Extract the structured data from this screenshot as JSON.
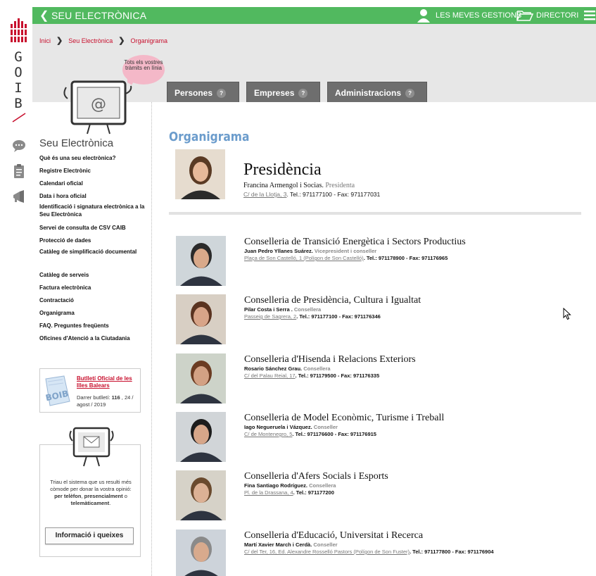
{
  "brand": {
    "letters": [
      "G",
      "O",
      "I",
      "B"
    ],
    "accent": "#c8102e",
    "green": "#51b95f"
  },
  "topbar": {
    "back_icon": "chevron-left-icon",
    "title": "SEU ELECTRÒNICA",
    "my_procedures": "LES MEVES GESTIONS",
    "directory": "DIRECTORI"
  },
  "breadcrumb": [
    "Inici",
    "Seu Electrònica",
    "Organigrama"
  ],
  "bubble": "Tots els vostres tràmits en línia",
  "tabs": [
    "Persones",
    "Empreses",
    "Administracions"
  ],
  "tab_help": "?",
  "sidebar": {
    "title": "Seu Electrònica",
    "items": [
      "Què és una seu electrònica?",
      "Registre Electrònic",
      "Calendari oficial",
      "Data i hora oficial",
      "Identificació i signatura electrònica a la Seu Electrònica",
      "Servei de consulta de CSV CAIB",
      "Protecció de dades",
      "Catàleg de simplificació documental",
      "Catàleg de serveis",
      "Factura electrònica",
      "Contractació",
      "Organigrama",
      "FAQ. Preguntes freqüents",
      "Oficines d'Atenció a la Ciutadania"
    ],
    "butlleti": {
      "logo": "BOIB",
      "title": "Butlletí Oficial de les Illes Balears",
      "last_prefix": "Darrer butlletí: ",
      "last_number": "116",
      "last_date": " , 24 / agost / 2019"
    },
    "opinio": {
      "text_1": "Triau el sistema que us resulti més còmode per donar la vostra opinió: ",
      "opt_1": "per telèfon",
      "sep_1": ", ",
      "opt_2": "presencialment",
      "sep_2": " o ",
      "opt_3": "telemàticament",
      "end": ".",
      "button": "Informació i queixes"
    }
  },
  "main": {
    "title": "Organigrama",
    "presidencia": {
      "name": "Presidència",
      "person": "Francina Armengol i Socias",
      "role": "Presidenta",
      "address": "C/ de la Llotja, 3",
      "tel_label": ". Tel.: ",
      "tel": "971177100",
      "fax_label": " - Fax: ",
      "fax": "971177031"
    },
    "departments": [
      {
        "name": "Conselleria de Transició Energètica i Sectors Productius",
        "person": "Juan Pedro Yllanes Suárez",
        "role": "Vicepresident i conseller",
        "address": "Plaça de Son Castelló, 1 (Polígon de Son Castelló)",
        "tel": "971178900",
        "fax": "971176965"
      },
      {
        "name": "Conselleria de Presidència, Cultura i Igualtat",
        "person": "Pilar Costa i Serra ",
        "role": "Consellera",
        "address": "Passeig de Sagrera, 2",
        "tel": "971177100",
        "fax": "971176346"
      },
      {
        "name": "Conselleria d'Hisenda i Relacions Exteriors",
        "person": "Rosario Sánchez Grau",
        "role": "Consellera",
        "address": "C/ del Palau Reial, 17",
        "tel": "971179500",
        "fax": "971176335"
      },
      {
        "name": "Conselleria de Model Econòmic, Turisme i Treball",
        "person": "Iago Negueruela i Vázquez",
        "role": "Conseller",
        "address": "C/ de Montenegro, 5",
        "tel": "971176600",
        "fax": "971176915"
      },
      {
        "name": "Conselleria d'Afers Socials i Esports",
        "person": "Fina Santiago Rodríguez",
        "role": "Consellera",
        "address": "Pl. de la Drassana, 4",
        "tel": "971177200",
        "fax": ""
      },
      {
        "name": "Conselleria d'Educació, Universitat i Recerca",
        "person": "Martí Xavier March i Cerdà",
        "role": "Conseller",
        "address": "C/ del Ter, 16, Ed. Alexandre Rosselló Pastors (Polígon de Son Fuster)",
        "tel": "971177800",
        "fax": "971176904"
      }
    ],
    "tel_label": ". Tel.: ",
    "fax_label": " - Fax: "
  }
}
